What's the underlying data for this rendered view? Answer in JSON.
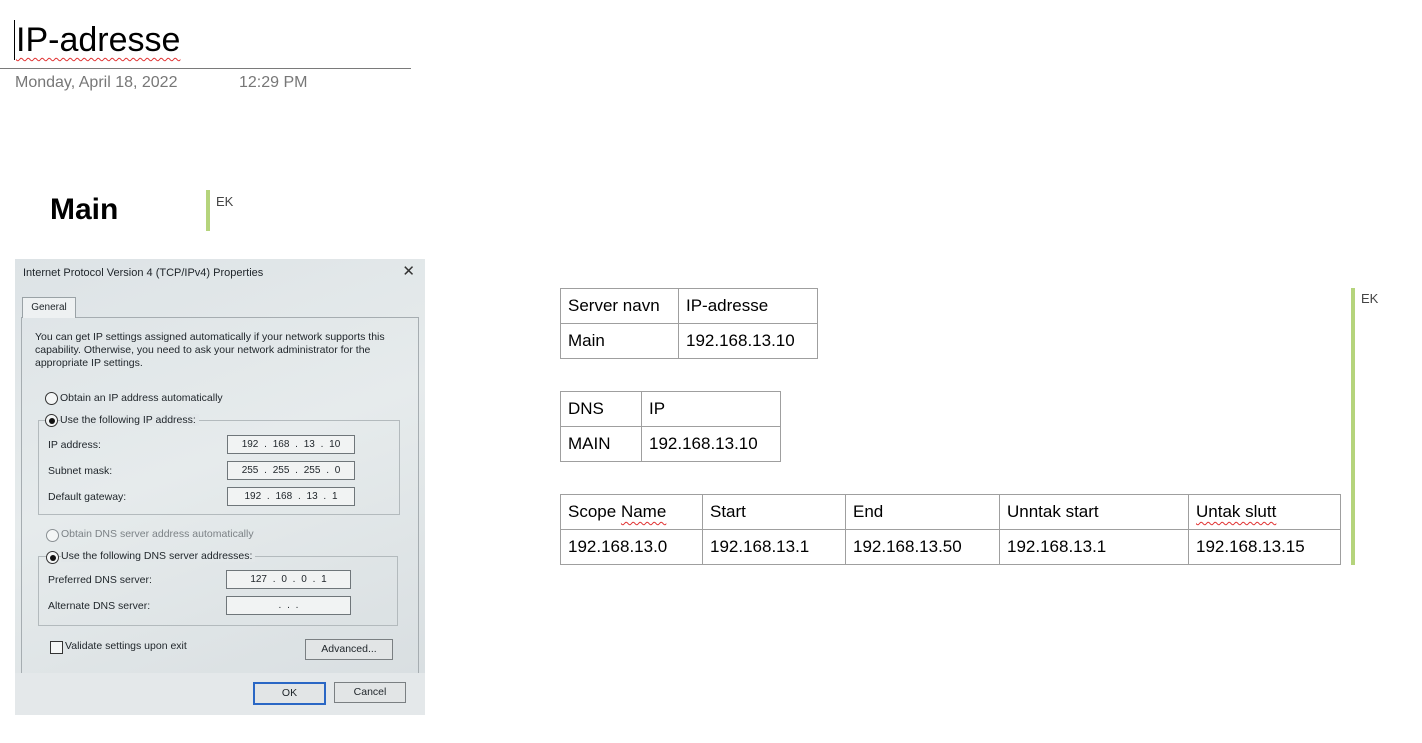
{
  "page": {
    "title": "IP-adresse",
    "date": "Monday, April 18, 2022",
    "time": "12:29 PM"
  },
  "section": {
    "heading": "Main",
    "author_initials": "EK"
  },
  "tables_author_initials": "EK",
  "dialog": {
    "title": "Internet Protocol Version 4 (TCP/IPv4) Properties",
    "close_glyph": "✕",
    "tab": "General",
    "intro": "You can get IP settings assigned automatically if your network supports this capability. Otherwise, you need to ask your network administrator for the appropriate IP settings.",
    "obtain_ip_auto": "Obtain an IP address automatically",
    "use_following_ip": "Use the following IP address:",
    "ip_address_label": "IP address:",
    "ip_address_value": "192 . 168 . 13 . 10",
    "subnet_mask_label": "Subnet mask:",
    "subnet_mask_value": "255 . 255 . 255 . 0",
    "default_gateway_label": "Default gateway:",
    "default_gateway_value": "192 . 168 . 13 . 1",
    "obtain_dns_auto": "Obtain DNS server address automatically",
    "use_following_dns": "Use the following DNS server addresses:",
    "preferred_dns_label": "Preferred DNS server:",
    "preferred_dns_value": "127 . 0 . 0 . 1",
    "alternate_dns_label": "Alternate DNS server:",
    "alternate_dns_value": ".     .     .",
    "validate_label": "Validate settings upon exit",
    "advanced_button": "Advanced...",
    "ok_button": "OK",
    "cancel_button": "Cancel",
    "ip_mode": "manual",
    "dns_mode": "manual",
    "validate_checked": false
  },
  "server_table": {
    "headers": [
      "Server navn",
      "IP-adresse"
    ],
    "rows": [
      [
        "Main",
        "192.168.13.10"
      ]
    ]
  },
  "dns_table": {
    "headers": [
      "DNS",
      "IP"
    ],
    "rows": [
      [
        "MAIN",
        "192.168.13.10"
      ]
    ]
  },
  "scope_table": {
    "headers": [
      "Scope Name",
      "Start",
      "End",
      "Unntak start",
      "Untak slutt"
    ],
    "rows": [
      [
        "192.168.13.0",
        "192.168.13.1",
        "192.168.13.50",
        "192.168.13.1",
        "192.168.13.15"
      ]
    ]
  },
  "colors": {
    "author_bar": "#b5d47c",
    "spell_squiggle": "#e03030",
    "table_border": "#9f9f9f"
  }
}
